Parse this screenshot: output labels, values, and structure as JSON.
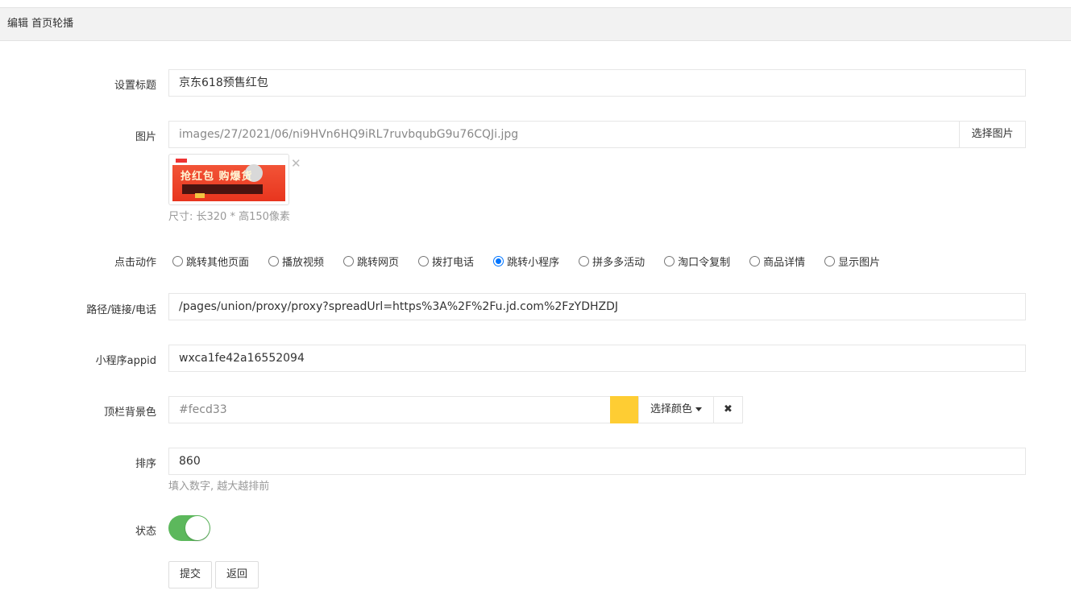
{
  "header": {
    "title": "编辑 首页轮播"
  },
  "form": {
    "title": {
      "label": "设置标题",
      "value": "京东618预售红包"
    },
    "image": {
      "label": "图片",
      "value": "images/27/2021/06/ni9HVn6HQ9iRL7ruvbqubG9u76CQJi.jpg",
      "button": "选择图片",
      "thumb_text": "抢红包 购爆货",
      "close": "✕",
      "hint": "尺寸: 长320 * 高150像素"
    },
    "action": {
      "label": "点击动作",
      "options": [
        {
          "label": "跳转其他页面",
          "checked": false
        },
        {
          "label": "播放视频",
          "checked": false
        },
        {
          "label": "跳转网页",
          "checked": false
        },
        {
          "label": "拨打电话",
          "checked": false
        },
        {
          "label": "跳转小程序",
          "checked": true
        },
        {
          "label": "拼多多活动",
          "checked": false
        },
        {
          "label": "淘口令复制",
          "checked": false
        },
        {
          "label": "商品详情",
          "checked": false
        },
        {
          "label": "显示图片",
          "checked": false
        }
      ]
    },
    "path": {
      "label": "路径/链接/电话",
      "value": "/pages/union/proxy/proxy?spreadUrl=https%3A%2F%2Fu.jd.com%2FzYDHZDJ"
    },
    "appid": {
      "label": "小程序appid",
      "value": "wxca1fe42a16552094"
    },
    "topbar_color": {
      "label": "顶栏背景色",
      "value": "#fecd33",
      "swatch": "#fecd33",
      "button": "选择颜色",
      "clear": "✖"
    },
    "sort": {
      "label": "排序",
      "value": "860",
      "hint": "填入数字, 越大越排前"
    },
    "status": {
      "label": "状态",
      "on": true,
      "color": "#5cb85c"
    },
    "buttons": {
      "submit": "提交",
      "back": "返回"
    }
  }
}
